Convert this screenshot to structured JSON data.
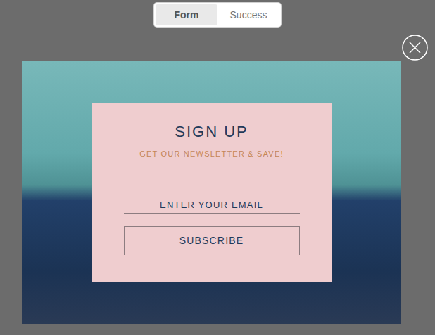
{
  "toggle": [
    {
      "label": "Form",
      "selected": true
    },
    {
      "label": "Success",
      "selected": false
    }
  ],
  "popup": {
    "title": "SIGN UP",
    "subtitle": "GET OUR NEWSLETTER & SAVE!",
    "email_placeholder": "ENTER YOUR EMAIL",
    "button": "SUBSCRIBE"
  }
}
